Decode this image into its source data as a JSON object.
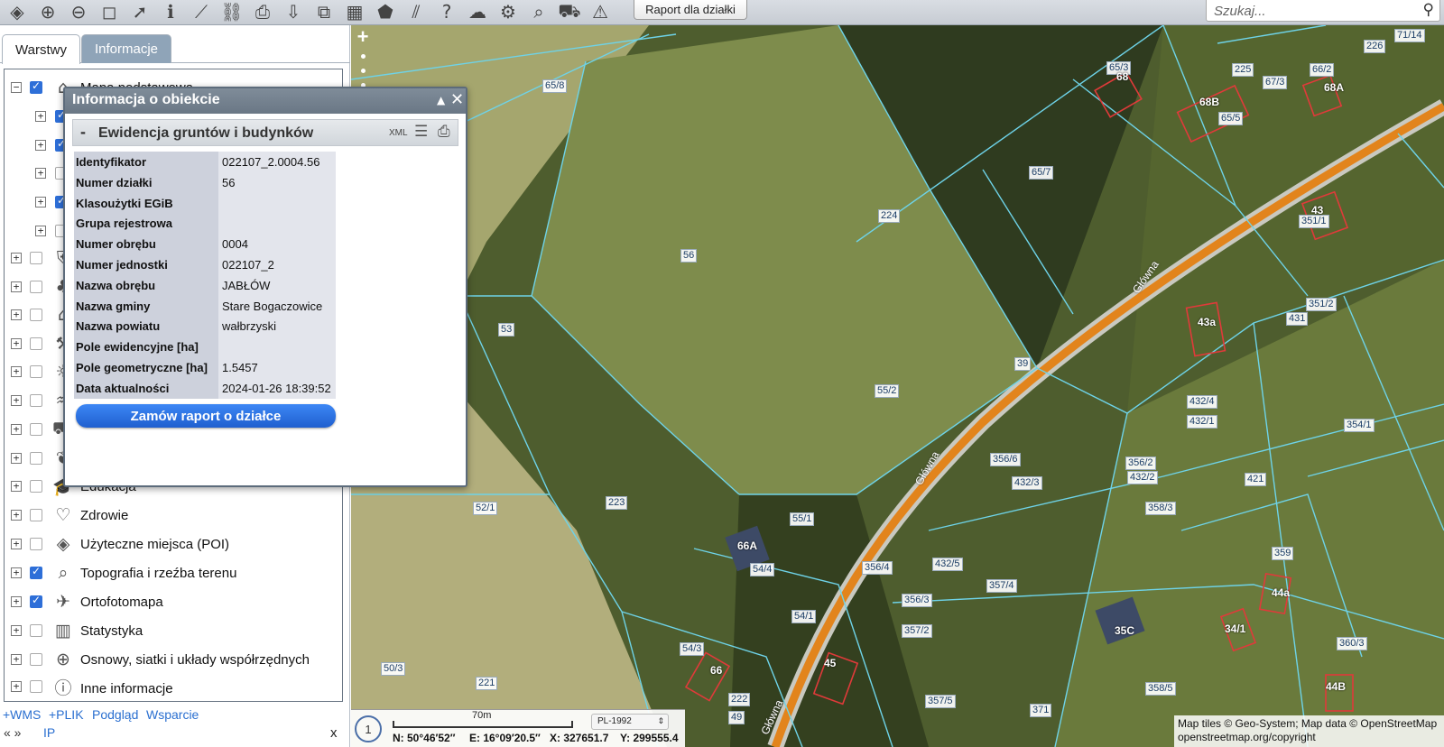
{
  "toolbar": {
    "icons": [
      "layers-icon",
      "zoom-in-icon",
      "zoom-out-icon",
      "full-extent-icon",
      "pointer-icon",
      "info-icon",
      "measure-icon",
      "link-icon",
      "print-icon",
      "download-icon",
      "export-icon",
      "layout-icon",
      "shape-icon",
      "hatch-icon",
      "help-icon",
      "cloud-icon",
      "settings-icon",
      "search-location-icon",
      "cart-icon",
      "warning-icon"
    ],
    "report_button": "Raport dla działki",
    "search_placeholder": "Szukaj..."
  },
  "tabs": {
    "layers": "Warstwy",
    "info": "Informacje"
  },
  "layers": [
    {
      "label": "",
      "checked": true,
      "expanded": true,
      "icon": "map-icon"
    },
    {
      "label": "",
      "checked": true,
      "expanded": false,
      "icon": ""
    },
    {
      "label": "",
      "checked": true,
      "expanded": false,
      "icon": ""
    },
    {
      "label": "",
      "checked": false,
      "expanded": false,
      "icon": ""
    },
    {
      "label": "",
      "checked": true,
      "expanded": false,
      "icon": ""
    },
    {
      "label": "",
      "checked": false,
      "expanded": false,
      "icon": ""
    },
    {
      "label": "",
      "checked": false,
      "expanded": false,
      "icon": "shield-icon"
    },
    {
      "label": "",
      "checked": false,
      "expanded": false,
      "icon": "tree-icon"
    },
    {
      "label": "",
      "checked": false,
      "expanded": false,
      "icon": "factory-icon"
    },
    {
      "label": "",
      "checked": false,
      "expanded": false,
      "icon": "tools-icon"
    },
    {
      "label": "",
      "checked": false,
      "expanded": false,
      "icon": "sun-icon"
    },
    {
      "label": "",
      "checked": false,
      "expanded": false,
      "icon": "water-icon"
    },
    {
      "label": "",
      "checked": false,
      "expanded": false,
      "icon": "transport-icon"
    },
    {
      "label": "",
      "checked": false,
      "expanded": false,
      "icon": "leaf-icon"
    },
    {
      "label": "Edukacja",
      "checked": false,
      "expanded": false,
      "icon": "graduation-cap-icon"
    },
    {
      "label": "Zdrowie",
      "checked": false,
      "expanded": false,
      "icon": "heart-icon"
    },
    {
      "label": "Użyteczne miejsca (POI)",
      "checked": false,
      "expanded": false,
      "icon": "layers-stack-icon"
    },
    {
      "label": "Topografia i rzeźba terenu",
      "checked": true,
      "expanded": false,
      "icon": "topo-magnifier-icon"
    },
    {
      "label": "Ortofotomapa",
      "checked": true,
      "expanded": false,
      "icon": "airplane-icon"
    },
    {
      "label": "Statystyka",
      "checked": false,
      "expanded": false,
      "icon": "chart-icon"
    },
    {
      "label": "Osnowy, siatki i układy współrzędnych",
      "checked": false,
      "expanded": false,
      "icon": "globe-icon"
    },
    {
      "label": "Inne informacje",
      "checked": false,
      "expanded": false,
      "icon": "info-circle-icon"
    }
  ],
  "first_layer_label_partial": "Mapa podstawowa",
  "bottom_links": [
    "+WMS",
    "+PLIK",
    "Podgląd",
    "Wsparcie"
  ],
  "bottom_nav": {
    "arrows": "« »",
    "ip": "IP",
    "close": "x"
  },
  "popup": {
    "title": "Informacja o obiekcie",
    "section_title": "Ewidencja gruntów i budynków",
    "section_toggle": "-",
    "xml_label": "XML",
    "attributes": [
      {
        "key": "Identyfikator",
        "value": "022107_2.0004.56"
      },
      {
        "key": "Numer działki",
        "value": "56"
      },
      {
        "key": "Klasoużytki EGiB",
        "value": ""
      },
      {
        "key": "Grupa rejestrowa",
        "value": ""
      },
      {
        "key": "Numer obrębu",
        "value": "0004"
      },
      {
        "key": "Numer jednostki",
        "value": "022107_2"
      },
      {
        "key": "Nazwa obrębu",
        "value": "JABŁÓW"
      },
      {
        "key": "Nazwa gminy",
        "value": "Stare Bogaczowice"
      },
      {
        "key": "Nazwa powiatu",
        "value": "wałbrzyski"
      },
      {
        "key": "Pole ewidencyjne [ha]",
        "value": ""
      },
      {
        "key": "Pole geometryczne [ha]",
        "value": "1.5457"
      },
      {
        "key": "Data aktualności",
        "value": "2024-01-26 18:39:52"
      }
    ],
    "order_button": "Zamów raport o działce"
  },
  "map": {
    "parcel_labels": [
      "65/8",
      "56",
      "53",
      "224",
      "65/7",
      "55/2",
      "223",
      "52/1",
      "55/1",
      "54/4",
      "54/1",
      "54/3",
      "50/3",
      "221",
      "222",
      "49",
      "356/6",
      "432/3",
      "356/4",
      "432/5",
      "357/4",
      "356/3",
      "357/2",
      "357/5",
      "371",
      "356/2",
      "432/2",
      "358/3",
      "421",
      "354/1",
      "432/4",
      "432/1",
      "431",
      "351/2",
      "351/1",
      "359",
      "360/3",
      "358/5",
      "225",
      "67/3",
      "66/2",
      "65/3",
      "65/5",
      "226",
      "71/14",
      "39"
    ],
    "building_labels": [
      "68",
      "68B",
      "68A",
      "43",
      "43a",
      "66A",
      "66",
      "45",
      "44a",
      "44B",
      "35C",
      "34/1"
    ],
    "road_label": "Główna",
    "zoom_in": "+"
  },
  "status": {
    "step": "1",
    "scale_label": "70m",
    "crs": "PL-1992",
    "north": "N: 50°46′52″",
    "east": "E: 16°09′20.5″",
    "x": "X: 327651.7",
    "y": "Y: 299555.4"
  },
  "attribution": {
    "line1": "Map tiles © Geo-System; Map data © OpenStreetMap",
    "line2": "openstreetmap.org/copyright"
  }
}
